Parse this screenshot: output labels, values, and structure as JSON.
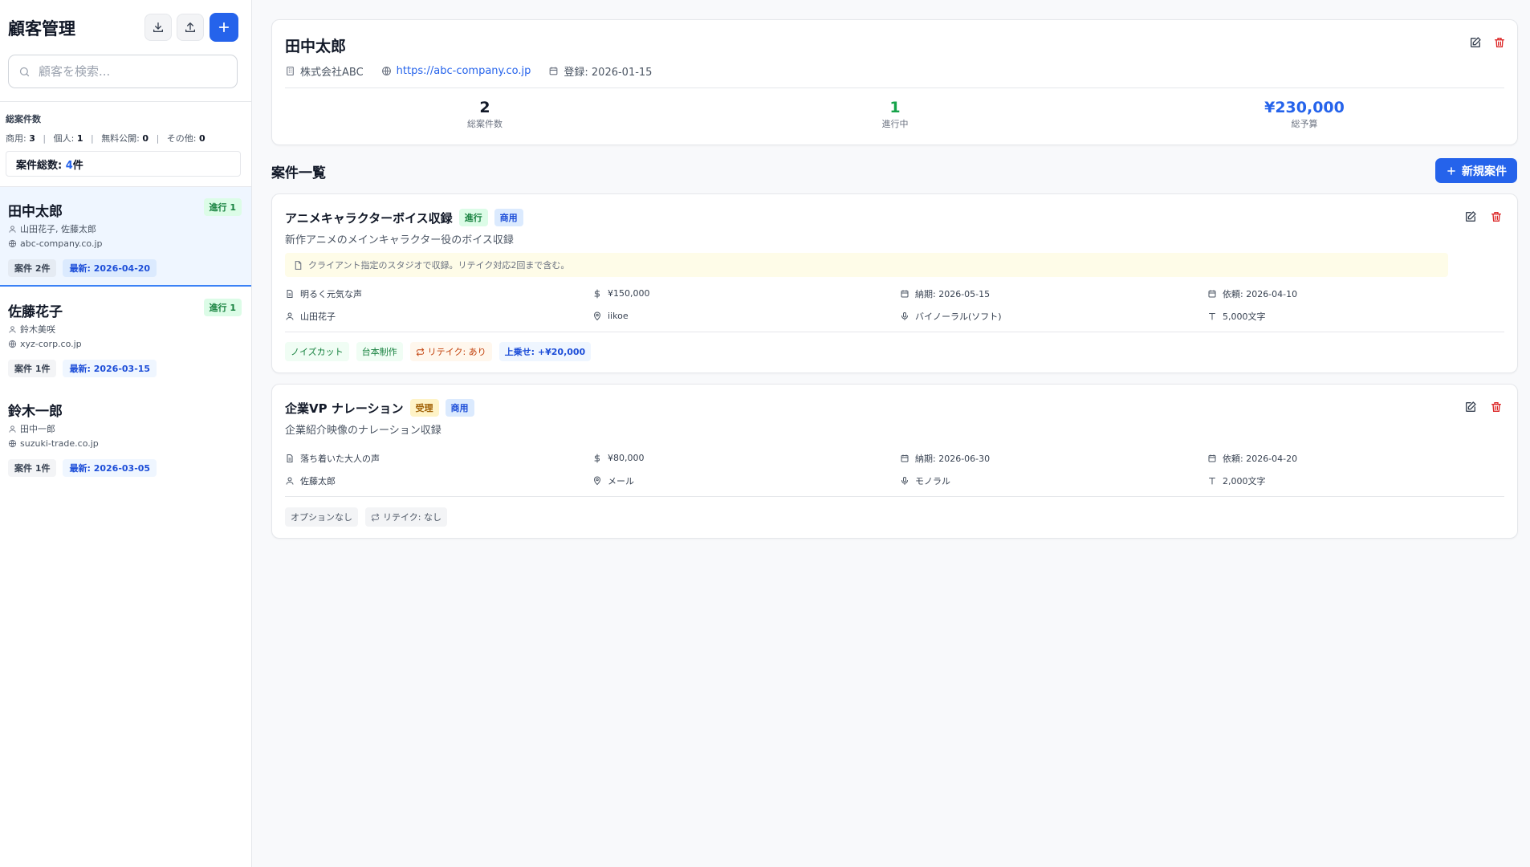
{
  "sidebar": {
    "title": "顧客管理",
    "search_placeholder": "顧客を検索...",
    "summary": {
      "label": "総案件数",
      "commercial_label": "商用:",
      "commercial": "3",
      "personal_label": "個人:",
      "personal": "1",
      "free_label": "無料公開:",
      "free": "0",
      "other_label": "その他:",
      "other": "0",
      "total_prefix": "案件総数: ",
      "total_num": "4",
      "total_suffix": "件"
    },
    "customers": [
      {
        "name": "田中太郎",
        "badge": "進行 1",
        "contacts": "山田花子, 佐藤太郎",
        "site": "abc-company.co.jp",
        "count": "案件 2件",
        "latest": "最新: 2026-04-20"
      },
      {
        "name": "佐藤花子",
        "badge": "進行 1",
        "contacts": "鈴木美咲",
        "site": "xyz-corp.co.jp",
        "count": "案件 1件",
        "latest": "最新: 2026-03-15"
      },
      {
        "name": "鈴木一郎",
        "badge": "",
        "contacts": "田中一郎",
        "site": "suzuki-trade.co.jp",
        "count": "案件 1件",
        "latest": "最新: 2026-03-05"
      }
    ]
  },
  "detail": {
    "name": "田中太郎",
    "company": "株式会社ABC",
    "url": "https://abc-company.co.jp",
    "registered": "登録: 2026-01-15",
    "stats": [
      {
        "value": "2",
        "label": "総案件数"
      },
      {
        "value": "1",
        "label": "進行中"
      },
      {
        "value": "¥230,000",
        "label": "総予算"
      }
    ]
  },
  "projects_section": {
    "title": "案件一覧",
    "new_button": "新規案件"
  },
  "projects": [
    {
      "title": "アニメキャラクターボイス収録",
      "status": "進行",
      "category": "商用",
      "description": "新作アニメのメインキャラクター役のボイス収録",
      "note": "クライアント指定のスタジオで収録。リテイク対応2回まで含む。",
      "voice": "明るく元気な声",
      "price": "¥150,000",
      "deadline": "納期: 2026-05-15",
      "requested": "依頼: 2026-04-10",
      "contact": "山田花子",
      "location": "iikoe",
      "audio": "バイノーラル(ソフト)",
      "chars": "5,000文字",
      "tags": {
        "noise": "ノイズカット",
        "script": "台本制作",
        "retake": "リテイク: あり",
        "extra": "上乗せ: +¥20,000"
      }
    },
    {
      "title": "企業VP ナレーション",
      "status": "受理",
      "category": "商用",
      "description": "企業紹介映像のナレーション収録",
      "voice": "落ち着いた大人の声",
      "price": "¥80,000",
      "deadline": "納期: 2026-06-30",
      "requested": "依頼: 2026-04-20",
      "contact": "佐藤太郎",
      "location": "メール",
      "audio": "モノラル",
      "chars": "2,000文字",
      "tags": {
        "option": "オプションなし",
        "retake": "リテイク: なし"
      }
    }
  ],
  "colors": {
    "accent": "#2563eb",
    "danger": "#dc2626",
    "success": "#16a34a"
  }
}
